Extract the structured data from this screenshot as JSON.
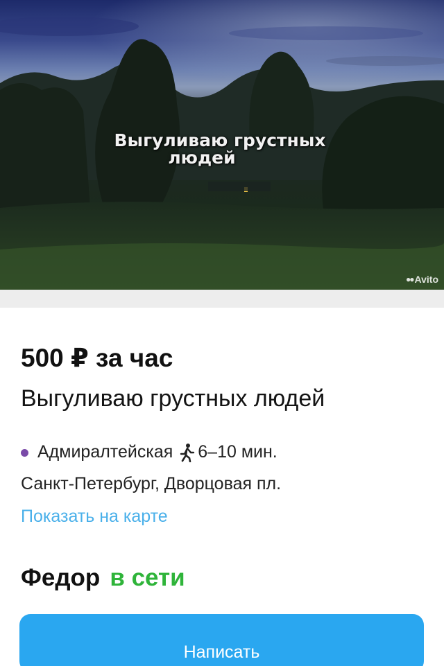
{
  "hero": {
    "caption_line1": "Выгуливаю грустных",
    "caption_line2": "людей",
    "watermark": "Avito",
    "watermark_icon": "avito-logo-icon"
  },
  "listing": {
    "price": "500 ₽ за час",
    "title": "Выгуливаю грустных людей",
    "metro": {
      "station": "Адмиралтейская",
      "line_color": "#7a4aa8",
      "walk_icon": "walking-person-icon",
      "walk_time": "6–10 мин."
    },
    "address": "Санкт-Петербург, Дворцовая пл.",
    "map_link": "Показать на карте"
  },
  "seller": {
    "name": "Федор",
    "status": "в сети",
    "status_color": "#2fb43a"
  },
  "actions": {
    "write_label": "Написать",
    "button_color": "#2aa7f0",
    "link_color": "#4ab0ea"
  }
}
